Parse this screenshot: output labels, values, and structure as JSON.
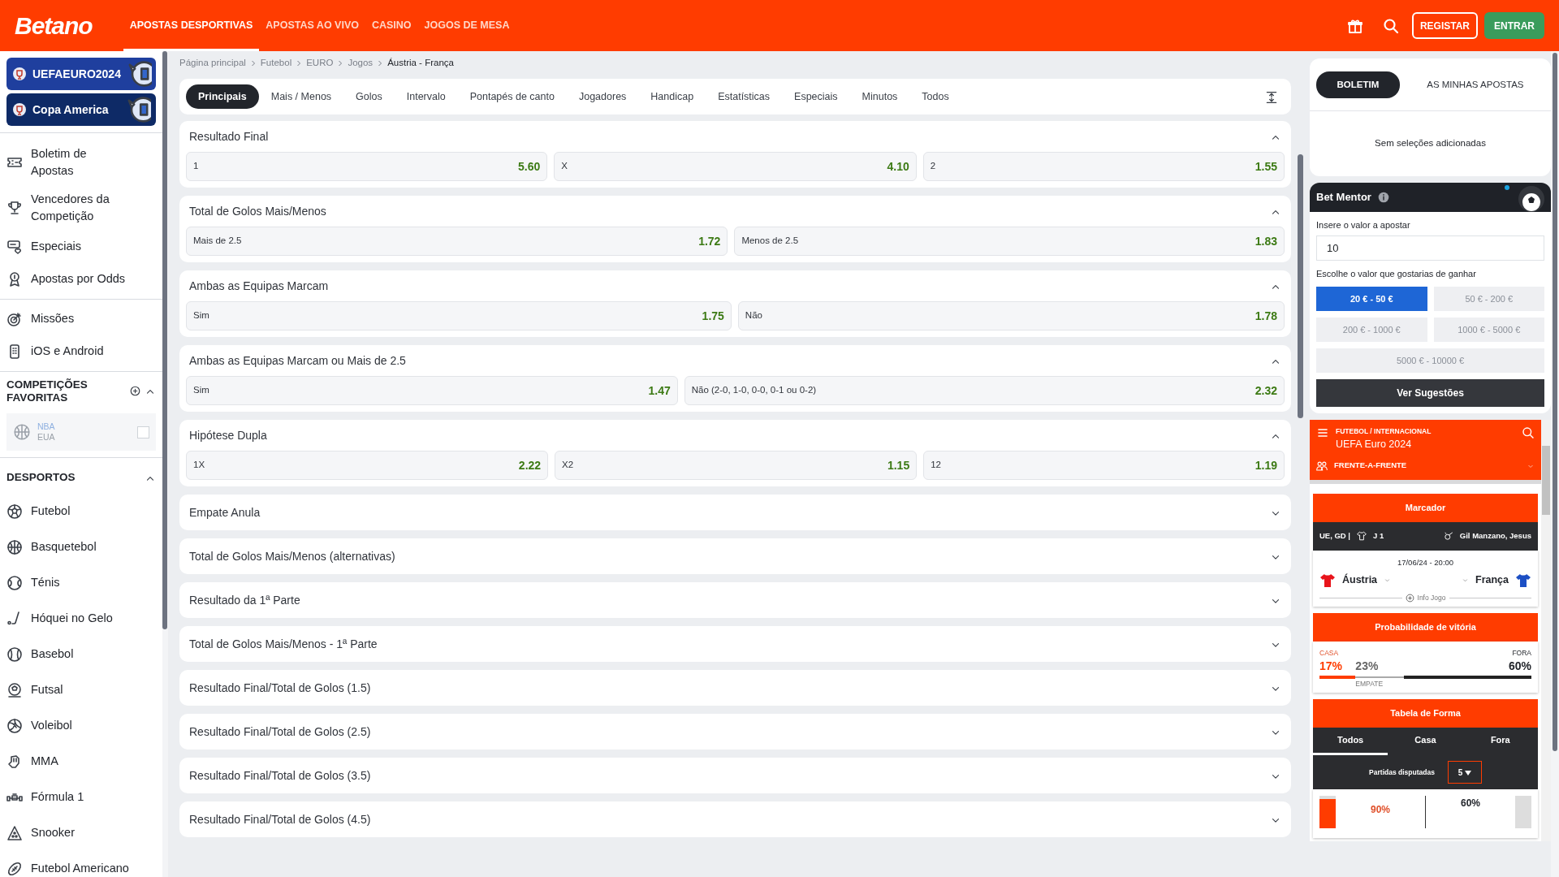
{
  "header": {
    "logo": "Betano",
    "nav": [
      {
        "label": "APOSTAS DESPORTIVAS",
        "selected": true
      },
      {
        "label": "APOSTAS AO VIVO",
        "selected": false
      },
      {
        "label": "CASINO",
        "selected": false
      },
      {
        "label": "JOGOS DE MESA",
        "selected": false
      }
    ],
    "register": "REGISTAR",
    "login": "ENTRAR"
  },
  "sidebar": {
    "banners": [
      {
        "label": "UEFAEURO2024",
        "color": "#1f3f9e"
      },
      {
        "label": "Copa America",
        "color": "#0e2a66"
      }
    ],
    "menu": [
      {
        "label": "Boletim de Apostas"
      },
      {
        "label": "Vencedores da Competição"
      },
      {
        "label": "Especiais"
      },
      {
        "label": "Apostas por Odds"
      },
      {
        "label": "Missões"
      },
      {
        "label": "iOS e Android"
      }
    ],
    "favorites": {
      "title": "COMPETIÇÕES FAVORITAS",
      "expanded": true,
      "items": [
        {
          "name": "NBA",
          "region": "EUA",
          "checked": false
        }
      ]
    },
    "sports": {
      "title": "DESPORTOS",
      "expanded": true,
      "items": [
        {
          "label": "Futebol"
        },
        {
          "label": "Basquetebol"
        },
        {
          "label": "Ténis"
        },
        {
          "label": "Hóquei no Gelo"
        },
        {
          "label": "Basebol"
        },
        {
          "label": "Futsal"
        },
        {
          "label": "Voleibol"
        },
        {
          "label": "MMA"
        },
        {
          "label": "Fórmula 1"
        },
        {
          "label": "Snooker"
        },
        {
          "label": "Futebol Americano"
        }
      ]
    }
  },
  "main": {
    "breadcrumb": [
      "Página principal",
      "Futebol",
      "EURO",
      "Jogos",
      "Áustria - França"
    ],
    "tabs": [
      {
        "label": "Principais",
        "selected": true
      },
      {
        "label": "Mais / Menos",
        "selected": false
      },
      {
        "label": "Golos",
        "selected": false
      },
      {
        "label": "Intervalo",
        "selected": false
      },
      {
        "label": "Pontapés de canto",
        "selected": false
      },
      {
        "label": "Jogadores",
        "selected": false
      },
      {
        "label": "Handicap",
        "selected": false
      },
      {
        "label": "Estatísticas",
        "selected": false
      },
      {
        "label": "Especiais",
        "selected": false
      },
      {
        "label": "Minutos",
        "selected": false
      },
      {
        "label": "Todos",
        "selected": false
      }
    ],
    "markets": [
      {
        "title": "Resultado Final",
        "expanded": true,
        "outcomes": [
          {
            "label": "1",
            "odds": "5.60"
          },
          {
            "label": "X",
            "odds": "4.10"
          },
          {
            "label": "2",
            "odds": "1.55"
          }
        ]
      },
      {
        "title": "Total de Golos Mais/Menos",
        "expanded": true,
        "outcomes": [
          {
            "label": "Mais de 2.5",
            "odds": "1.72"
          },
          {
            "label": "Menos de 2.5",
            "odds": "1.83"
          }
        ]
      },
      {
        "title": "Ambas as Equipas Marcam",
        "expanded": true,
        "outcomes": [
          {
            "label": "Sim",
            "odds": "1.75"
          },
          {
            "label": "Não",
            "odds": "1.78"
          }
        ]
      },
      {
        "title": "Ambas as Equipas Marcam ou Mais de 2.5",
        "expanded": true,
        "outcomes": [
          {
            "label": "Sim",
            "odds": "1.47"
          },
          {
            "label": "Não (2-0, 1-0, 0-0, 0-1 ou 0-2)",
            "odds": "2.32"
          }
        ]
      },
      {
        "title": "Hipótese Dupla",
        "expanded": true,
        "outcomes": [
          {
            "label": "1X",
            "odds": "2.22"
          },
          {
            "label": "X2",
            "odds": "1.15"
          },
          {
            "label": "12",
            "odds": "1.19"
          }
        ]
      },
      {
        "title": "Empate Anula",
        "expanded": false
      },
      {
        "title": "Total de Golos Mais/Menos (alternativas)",
        "expanded": false
      },
      {
        "title": "Resultado da 1ª Parte",
        "expanded": false
      },
      {
        "title": "Total de Golos Mais/Menos - 1ª Parte",
        "expanded": false
      },
      {
        "title": "Resultado Final/Total de Golos (1.5)",
        "expanded": false
      },
      {
        "title": "Resultado Final/Total de Golos (2.5)",
        "expanded": false
      },
      {
        "title": "Resultado Final/Total de Golos (3.5)",
        "expanded": false
      },
      {
        "title": "Resultado Final/Total de Golos (4.5)",
        "expanded": false
      }
    ]
  },
  "betslip": {
    "tabs": [
      {
        "label": "BOLETIM",
        "selected": true
      },
      {
        "label": "AS MINHAS APOSTAS",
        "selected": false
      }
    ],
    "empty_text": "Sem seleções adicionadas"
  },
  "bet_mentor": {
    "title": "Bet Mentor",
    "stake_label": "Insere o valor a apostar",
    "stake_value": "10",
    "target_label": "Escolhe o valor que gostarias de ganhar",
    "ranges": [
      {
        "label": "20 € - 50 €",
        "selected": true
      },
      {
        "label": "50 € - 200 €",
        "selected": false
      },
      {
        "label": "200 € - 1000 €",
        "selected": false
      },
      {
        "label": "1000 € - 5000 €",
        "selected": false
      },
      {
        "label": "5000 € - 10000 €",
        "selected": false
      }
    ],
    "button": "Ver Sugestões"
  },
  "widget": {
    "category": "FUTEBOL / INTERNACIONAL",
    "competition": "UEFA Euro 2024",
    "view": "FRENTE-A-FRENTE",
    "scoreboard": {
      "title": "Marcador",
      "info": "UE, GD |",
      "round": "J 1",
      "referee": "Gil Manzano, Jesus",
      "datetime": "17/06/24 - 20:00",
      "home": {
        "name": "Áustria",
        "color": "#e8141b"
      },
      "away": {
        "name": "França",
        "color": "#1c4fc4"
      },
      "info_link": "Info Jogo"
    },
    "probability": {
      "title": "Probabilidade de vitória",
      "home_label": "CASA",
      "home": "17%",
      "draw": "23%",
      "draw_label": "EMPATE",
      "away_label": "FORA",
      "away": "60%"
    },
    "form": {
      "title": "Tabela de Forma",
      "tabs": [
        {
          "label": "Todos",
          "selected": true
        },
        {
          "label": "Casa",
          "selected": false
        },
        {
          "label": "Fora",
          "selected": false
        }
      ],
      "played_label": "Partidas disputadas",
      "played_value": "5",
      "home_pct": "90%",
      "away_pct": "60%"
    }
  }
}
